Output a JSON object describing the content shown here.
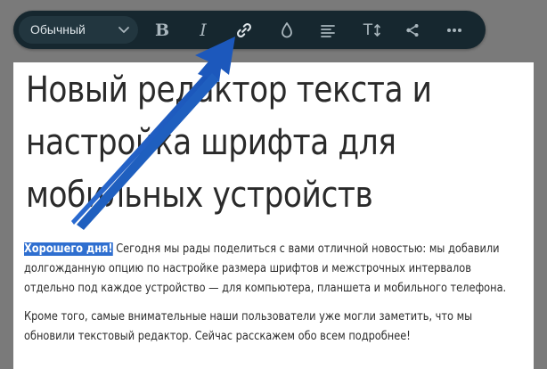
{
  "toolbar": {
    "style_select": {
      "value": "Обычный",
      "icon": "chevron-down-icon"
    },
    "buttons": [
      {
        "id": "bold",
        "label": "B",
        "icon": "bold-icon"
      },
      {
        "id": "italic",
        "label": "I",
        "icon": "italic-icon"
      },
      {
        "id": "link",
        "icon": "link-icon"
      },
      {
        "id": "color",
        "icon": "drop-icon"
      },
      {
        "id": "align",
        "icon": "align-left-icon"
      },
      {
        "id": "font_size",
        "label": "T",
        "icon": "text-size-icon"
      },
      {
        "id": "share",
        "icon": "share-icon"
      },
      {
        "id": "more",
        "icon": "more-icon"
      }
    ],
    "colors": {
      "background": "#16272f",
      "select_bg": "#22363f",
      "icon": "#a9b6bd",
      "link_icon": "#dfe6ea"
    }
  },
  "document": {
    "title": "Новый редактор текста и настройка шрифта для мобильных устройств",
    "paragraph1": {
      "selected": "Хорошего дня!",
      "rest": " Сегодня мы рады поделиться с вами отличной новостью: мы добавили долгожданную опцию по настройке размера шрифтов и межстрочных интервалов отдельно под каждое устройство — для компьютера, планшета и мобильного телефона."
    },
    "paragraph2": "Кроме того, самые внимательные наши пользователи уже могли заметить, что мы обновили текстовый редактор. Сейчас расскажем обо всем подробнее!"
  },
  "annotation": {
    "arrow_color": "#1f5fbf",
    "points_to": "link-button"
  }
}
